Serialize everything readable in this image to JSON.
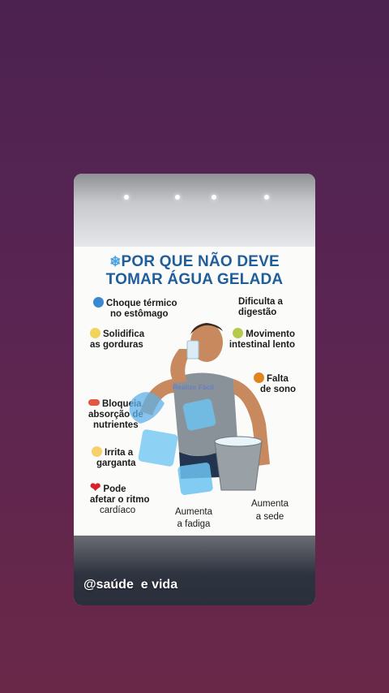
{
  "story": {
    "title_icon": "ice-cube-icon",
    "title_line1": "POR QUE NÃO DEVE",
    "title_line2": "TOMAR ÁGUA GELADA",
    "items": [
      {
        "label_line1": "Choque térmico",
        "label_line2": "no estômago",
        "icon": "snowflake-icon"
      },
      {
        "label_line1": "Solidifica",
        "label_line2": "as gorduras",
        "icon": "butter-icon"
      },
      {
        "label_line1": "Bloqueia a",
        "label_line2": "absorção de",
        "label_line3": "nutrientes",
        "icon": "pill-icon"
      },
      {
        "label_line1": "Irrita a",
        "label_line2": "garganta",
        "icon": "mask-face-icon"
      },
      {
        "label_line1": "Pode",
        "label_line2": "afetar o ritmo",
        "label_line3": "cardíaco",
        "icon": "heart-icon"
      },
      {
        "label_line1": "Dificulta a",
        "label_line2": "digestão"
      },
      {
        "label_line1": "Movimento",
        "label_line2": "intestinal lento",
        "icon": "sick-face-icon"
      },
      {
        "label_line1": "Falta",
        "label_line2": "de sono",
        "icon": "angry-face-icon"
      },
      {
        "label_line1": "Aumenta",
        "label_line2": "a fadiga"
      },
      {
        "label_line1": "Aumenta",
        "label_line2": "a sede"
      }
    ],
    "watermark": "Realize Fácil",
    "handle": "@saúde  e vida"
  },
  "colors": {
    "background": "#5a2553",
    "title": "#1f5e9a",
    "heart": "#d6222d"
  }
}
